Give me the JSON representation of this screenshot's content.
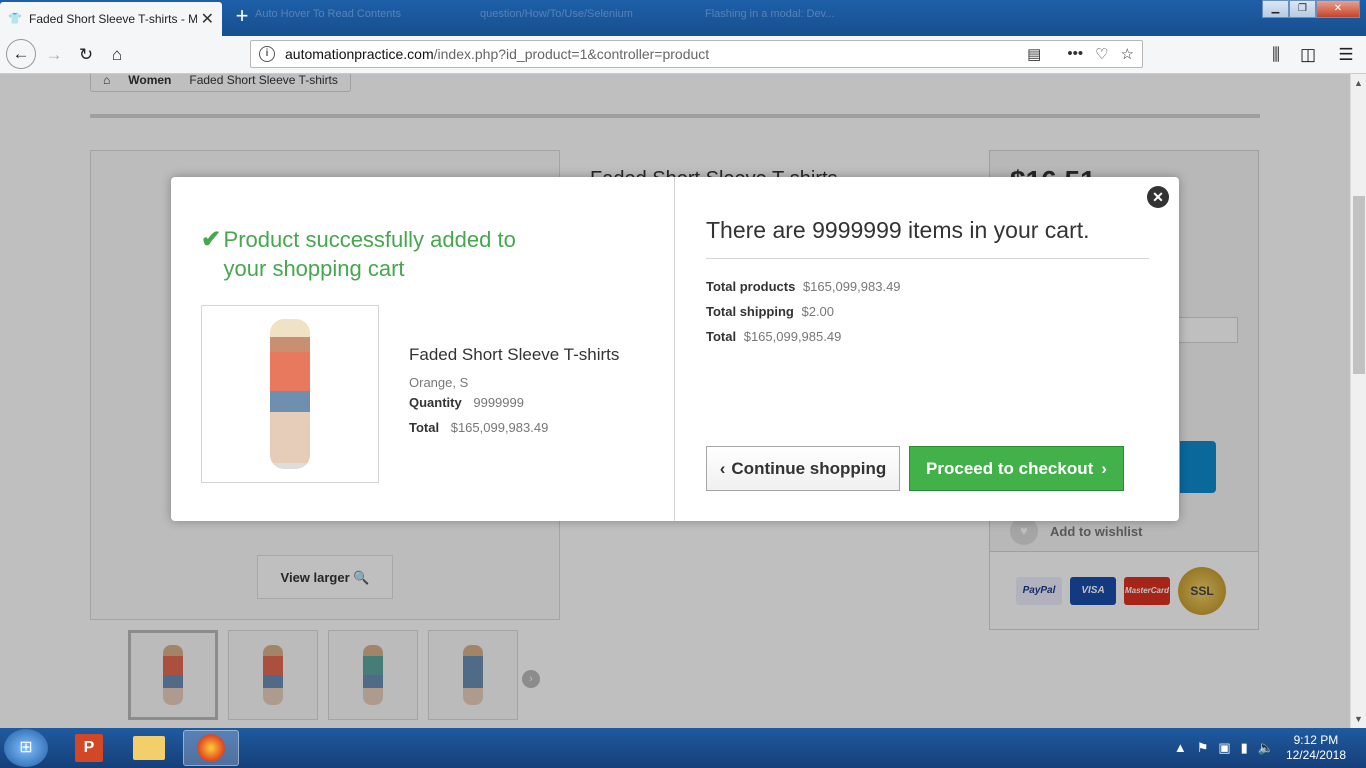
{
  "browser": {
    "tab_title": "Faded Short Sleeve T-shirts - M",
    "other_tabs": [
      "Auto Hover To Read Contents",
      "question/How/To/Use/Selenium",
      "Flashing in a modal: Dev..."
    ],
    "url_host": "automationpractice.com",
    "url_path": "/index.php?id_product=1&controller=product",
    "window_buttons": {
      "minimize": "▁",
      "maximize": "❐",
      "close": "✕"
    }
  },
  "page": {
    "breadcrumb": {
      "home_icon": "home-icon",
      "category": "Women",
      "current": "Faded Short Sleeve T-shirts"
    },
    "product_title": "Faded Short Sleeve T-shirts",
    "price": "$16.51",
    "view_larger": "View larger",
    "wishlist": "Add to wishlist",
    "payments": [
      "PayPal",
      "VISA",
      "MasterCard",
      "SSL"
    ]
  },
  "modal": {
    "success_msg": "Product successfully added to your shopping cart",
    "product_name": "Faded Short Sleeve T-shirts",
    "attributes": "Orange, S",
    "quantity_label": "Quantity",
    "quantity_value": "9999999",
    "total_label": "Total",
    "total_value": "$165,099,983.49",
    "cart_heading": "There are 9999999 items in your cart.",
    "total_products_label": "Total products",
    "total_products_value": "$165,099,983.49",
    "total_shipping_label": "Total shipping",
    "total_shipping_value": "$2.00",
    "grand_total_label": "Total",
    "grand_total_value": "$165,099,985.49",
    "continue_label": "Continue shopping",
    "checkout_label": "Proceed to checkout"
  },
  "taskbar": {
    "time": "9:12 PM",
    "date": "12/24/2018"
  },
  "colors": {
    "success": "#46a74e",
    "checkout_btn": "#43b149",
    "taskbar": "#1f5aa0"
  }
}
